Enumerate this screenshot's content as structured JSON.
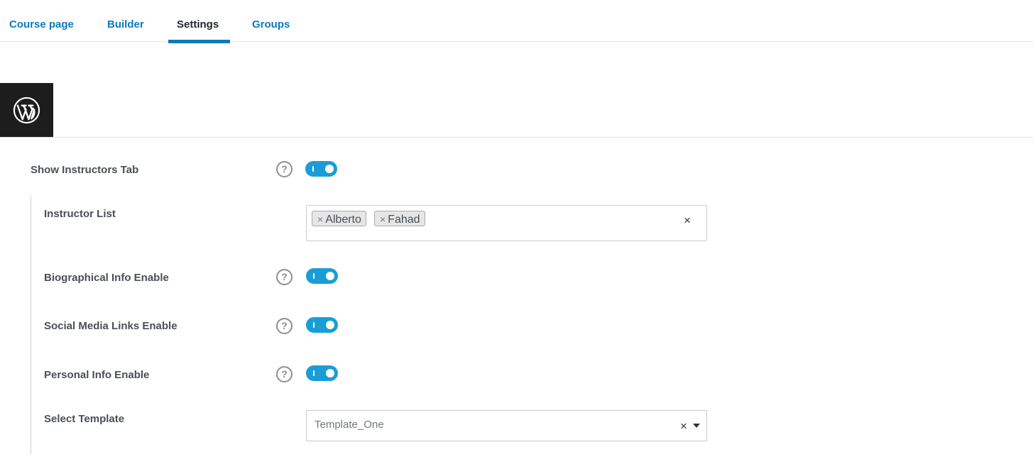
{
  "tabs": [
    {
      "label": "Course page",
      "active": false
    },
    {
      "label": "Builder",
      "active": false
    },
    {
      "label": "Settings",
      "active": true
    },
    {
      "label": "Groups",
      "active": false
    }
  ],
  "header": {
    "logo_icon": "wordpress-logo-icon"
  },
  "settings": {
    "show_instructors_tab": {
      "label": "Show Instructors Tab",
      "enabled": true
    },
    "instructor_list": {
      "label": "Instructor List",
      "selected": [
        "Alberto",
        "Fahad"
      ],
      "remove_glyph": "×",
      "clear_glyph": "×"
    },
    "biographical_info": {
      "label": "Biographical Info Enable",
      "enabled": true
    },
    "social_media_links": {
      "label": "Social Media Links Enable",
      "enabled": true
    },
    "personal_info": {
      "label": "Personal Info Enable",
      "enabled": true
    },
    "select_template": {
      "label": "Select Template",
      "value": "Template_One",
      "clear_glyph": "×"
    }
  },
  "help_glyph": "?",
  "colors": {
    "accent": "#1a9dd6",
    "tab_link": "#0e7ab8",
    "logo_bg": "#1d1d1d"
  }
}
